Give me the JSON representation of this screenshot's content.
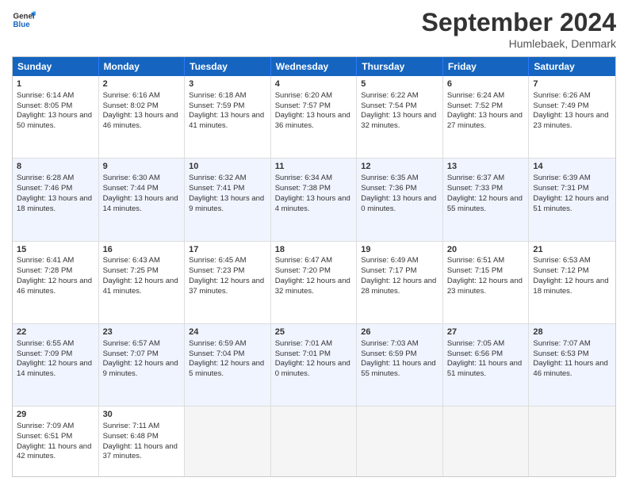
{
  "header": {
    "logo_line1": "General",
    "logo_line2": "Blue",
    "month_year": "September 2024",
    "location": "Humlebaek, Denmark"
  },
  "days_of_week": [
    "Sunday",
    "Monday",
    "Tuesday",
    "Wednesday",
    "Thursday",
    "Friday",
    "Saturday"
  ],
  "rows": [
    {
      "alt": false,
      "cells": [
        {
          "day": "1",
          "rise": "Sunrise: 6:14 AM",
          "set": "Sunset: 8:05 PM",
          "daylight": "Daylight: 13 hours and 50 minutes."
        },
        {
          "day": "2",
          "rise": "Sunrise: 6:16 AM",
          "set": "Sunset: 8:02 PM",
          "daylight": "Daylight: 13 hours and 46 minutes."
        },
        {
          "day": "3",
          "rise": "Sunrise: 6:18 AM",
          "set": "Sunset: 7:59 PM",
          "daylight": "Daylight: 13 hours and 41 minutes."
        },
        {
          "day": "4",
          "rise": "Sunrise: 6:20 AM",
          "set": "Sunset: 7:57 PM",
          "daylight": "Daylight: 13 hours and 36 minutes."
        },
        {
          "day": "5",
          "rise": "Sunrise: 6:22 AM",
          "set": "Sunset: 7:54 PM",
          "daylight": "Daylight: 13 hours and 32 minutes."
        },
        {
          "day": "6",
          "rise": "Sunrise: 6:24 AM",
          "set": "Sunset: 7:52 PM",
          "daylight": "Daylight: 13 hours and 27 minutes."
        },
        {
          "day": "7",
          "rise": "Sunrise: 6:26 AM",
          "set": "Sunset: 7:49 PM",
          "daylight": "Daylight: 13 hours and 23 minutes."
        }
      ]
    },
    {
      "alt": true,
      "cells": [
        {
          "day": "8",
          "rise": "Sunrise: 6:28 AM",
          "set": "Sunset: 7:46 PM",
          "daylight": "Daylight: 13 hours and 18 minutes."
        },
        {
          "day": "9",
          "rise": "Sunrise: 6:30 AM",
          "set": "Sunset: 7:44 PM",
          "daylight": "Daylight: 13 hours and 14 minutes."
        },
        {
          "day": "10",
          "rise": "Sunrise: 6:32 AM",
          "set": "Sunset: 7:41 PM",
          "daylight": "Daylight: 13 hours and 9 minutes."
        },
        {
          "day": "11",
          "rise": "Sunrise: 6:34 AM",
          "set": "Sunset: 7:38 PM",
          "daylight": "Daylight: 13 hours and 4 minutes."
        },
        {
          "day": "12",
          "rise": "Sunrise: 6:35 AM",
          "set": "Sunset: 7:36 PM",
          "daylight": "Daylight: 13 hours and 0 minutes."
        },
        {
          "day": "13",
          "rise": "Sunrise: 6:37 AM",
          "set": "Sunset: 7:33 PM",
          "daylight": "Daylight: 12 hours and 55 minutes."
        },
        {
          "day": "14",
          "rise": "Sunrise: 6:39 AM",
          "set": "Sunset: 7:31 PM",
          "daylight": "Daylight: 12 hours and 51 minutes."
        }
      ]
    },
    {
      "alt": false,
      "cells": [
        {
          "day": "15",
          "rise": "Sunrise: 6:41 AM",
          "set": "Sunset: 7:28 PM",
          "daylight": "Daylight: 12 hours and 46 minutes."
        },
        {
          "day": "16",
          "rise": "Sunrise: 6:43 AM",
          "set": "Sunset: 7:25 PM",
          "daylight": "Daylight: 12 hours and 41 minutes."
        },
        {
          "day": "17",
          "rise": "Sunrise: 6:45 AM",
          "set": "Sunset: 7:23 PM",
          "daylight": "Daylight: 12 hours and 37 minutes."
        },
        {
          "day": "18",
          "rise": "Sunrise: 6:47 AM",
          "set": "Sunset: 7:20 PM",
          "daylight": "Daylight: 12 hours and 32 minutes."
        },
        {
          "day": "19",
          "rise": "Sunrise: 6:49 AM",
          "set": "Sunset: 7:17 PM",
          "daylight": "Daylight: 12 hours and 28 minutes."
        },
        {
          "day": "20",
          "rise": "Sunrise: 6:51 AM",
          "set": "Sunset: 7:15 PM",
          "daylight": "Daylight: 12 hours and 23 minutes."
        },
        {
          "day": "21",
          "rise": "Sunrise: 6:53 AM",
          "set": "Sunset: 7:12 PM",
          "daylight": "Daylight: 12 hours and 18 minutes."
        }
      ]
    },
    {
      "alt": true,
      "cells": [
        {
          "day": "22",
          "rise": "Sunrise: 6:55 AM",
          "set": "Sunset: 7:09 PM",
          "daylight": "Daylight: 12 hours and 14 minutes."
        },
        {
          "day": "23",
          "rise": "Sunrise: 6:57 AM",
          "set": "Sunset: 7:07 PM",
          "daylight": "Daylight: 12 hours and 9 minutes."
        },
        {
          "day": "24",
          "rise": "Sunrise: 6:59 AM",
          "set": "Sunset: 7:04 PM",
          "daylight": "Daylight: 12 hours and 5 minutes."
        },
        {
          "day": "25",
          "rise": "Sunrise: 7:01 AM",
          "set": "Sunset: 7:01 PM",
          "daylight": "Daylight: 12 hours and 0 minutes."
        },
        {
          "day": "26",
          "rise": "Sunrise: 7:03 AM",
          "set": "Sunset: 6:59 PM",
          "daylight": "Daylight: 11 hours and 55 minutes."
        },
        {
          "day": "27",
          "rise": "Sunrise: 7:05 AM",
          "set": "Sunset: 6:56 PM",
          "daylight": "Daylight: 11 hours and 51 minutes."
        },
        {
          "day": "28",
          "rise": "Sunrise: 7:07 AM",
          "set": "Sunset: 6:53 PM",
          "daylight": "Daylight: 11 hours and 46 minutes."
        }
      ]
    },
    {
      "alt": false,
      "last": true,
      "cells": [
        {
          "day": "29",
          "rise": "Sunrise: 7:09 AM",
          "set": "Sunset: 6:51 PM",
          "daylight": "Daylight: 11 hours and 42 minutes."
        },
        {
          "day": "30",
          "rise": "Sunrise: 7:11 AM",
          "set": "Sunset: 6:48 PM",
          "daylight": "Daylight: 11 hours and 37 minutes."
        },
        {
          "day": "",
          "rise": "",
          "set": "",
          "daylight": ""
        },
        {
          "day": "",
          "rise": "",
          "set": "",
          "daylight": ""
        },
        {
          "day": "",
          "rise": "",
          "set": "",
          "daylight": ""
        },
        {
          "day": "",
          "rise": "",
          "set": "",
          "daylight": ""
        },
        {
          "day": "",
          "rise": "",
          "set": "",
          "daylight": ""
        }
      ]
    }
  ]
}
